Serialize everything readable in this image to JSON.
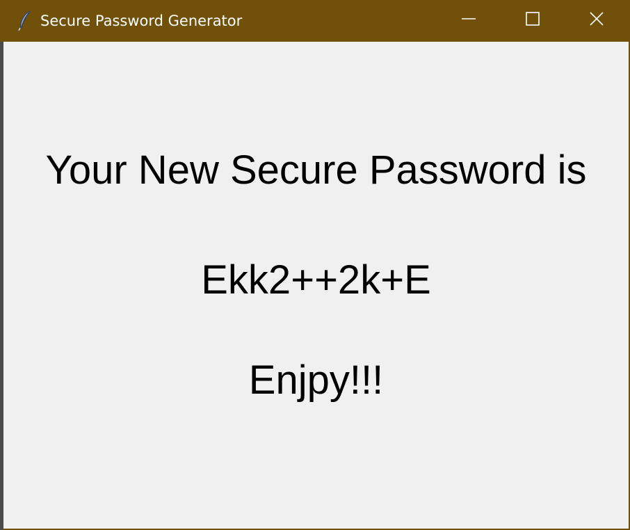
{
  "window": {
    "title": "Secure Password Generator",
    "app_icon": "feather-icon",
    "titlebar_color": "#715009",
    "controls": {
      "minimize_icon": "minimize-icon",
      "maximize_icon": "maximize-icon",
      "close_icon": "close-icon"
    }
  },
  "content": {
    "heading": "Your New Secure Password is",
    "password": "Ekk2++2k+E",
    "closing": "Enjpy!!!",
    "background": "#f0f0f0",
    "text_color": "#000000"
  }
}
